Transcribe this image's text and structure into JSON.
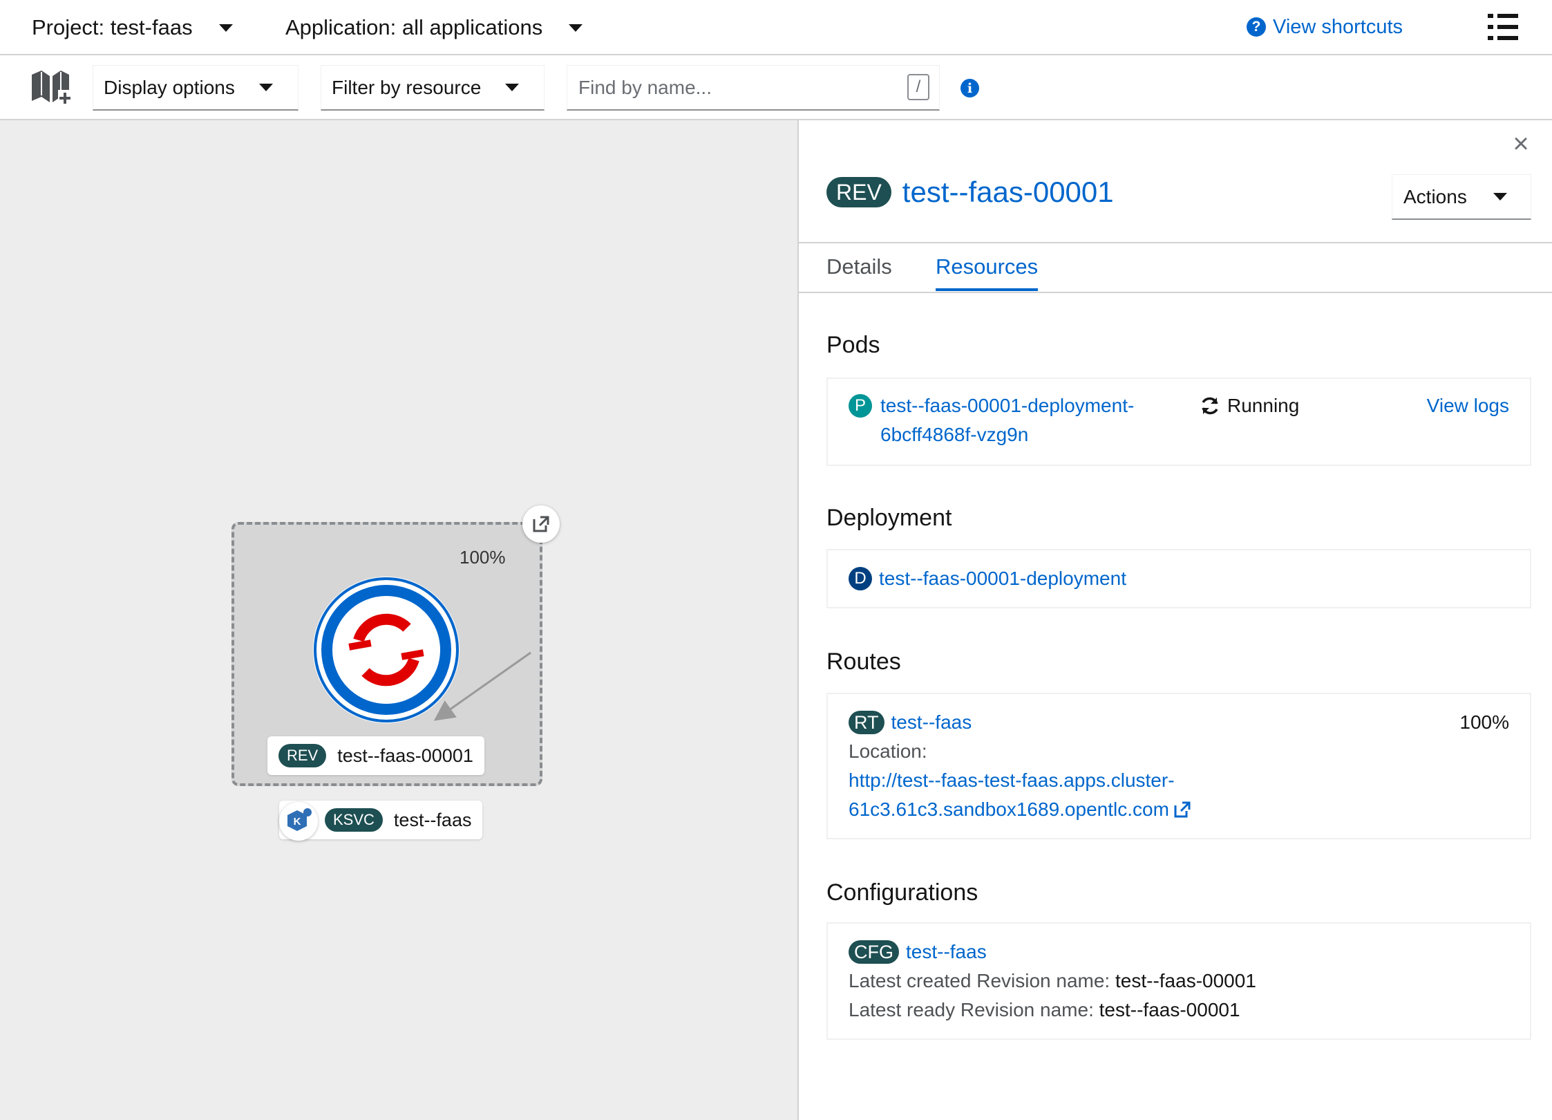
{
  "header": {
    "project_label": "Project: test-faas",
    "application_label": "Application: all applications",
    "shortcuts_label": "View shortcuts"
  },
  "toolbar": {
    "display_options": "Display options",
    "filter_by_resource": "Filter by resource",
    "search_placeholder": "Find by name...",
    "search_shortcut_key": "/"
  },
  "topology": {
    "traffic_percent": "100%",
    "revision_badge": "REV",
    "revision_name": "test--faas-00001",
    "service_badge": "KSVC",
    "service_name": "test--faas",
    "service_icon_letter": "K"
  },
  "panel": {
    "close_glyph": "×",
    "title_badge": "REV",
    "title": "test--faas-00001",
    "actions_label": "Actions",
    "tabs": [
      {
        "label": "Details",
        "active": false
      },
      {
        "label": "Resources",
        "active": true
      }
    ],
    "pods": {
      "heading": "Pods",
      "badge": "P",
      "name_line1": "test--faas-00001-deployment-",
      "name_line2": "6bcff4868f-vzg9n",
      "status": "Running",
      "view_logs": "View logs"
    },
    "deployment": {
      "heading": "Deployment",
      "badge": "D",
      "name": "test--faas-00001-deployment"
    },
    "routes": {
      "heading": "Routes",
      "badge": "RT",
      "name": "test--faas",
      "percent": "100%",
      "location_label": "Location:",
      "url_line1": "http://test--faas-test-faas.apps.cluster-",
      "url_line2": "61c3.61c3.sandbox1689.opentlc.com"
    },
    "configurations": {
      "heading": "Configurations",
      "badge": "CFG",
      "name": "test--faas",
      "latest_created_label": "Latest created Revision name:",
      "latest_created_value": "test--faas-00001",
      "latest_ready_label": "Latest ready Revision name:",
      "latest_ready_value": "test--faas-00001"
    }
  },
  "colors": {
    "link": "#0066cc",
    "badge_dark_teal": "#1e4f52",
    "pod_badge": "#009596",
    "deployment_badge": "#004080",
    "canvas_bg": "#ededed",
    "node_ring": "#0066cc",
    "logo_red": "#e00"
  },
  "icons": [
    "caret-down-icon",
    "question-circle-icon",
    "list-icon",
    "add-to-project-book-icon",
    "info-icon",
    "external-link-icon",
    "sync-icon",
    "close-icon",
    "openshift-logo-icon",
    "knative-icon"
  ]
}
